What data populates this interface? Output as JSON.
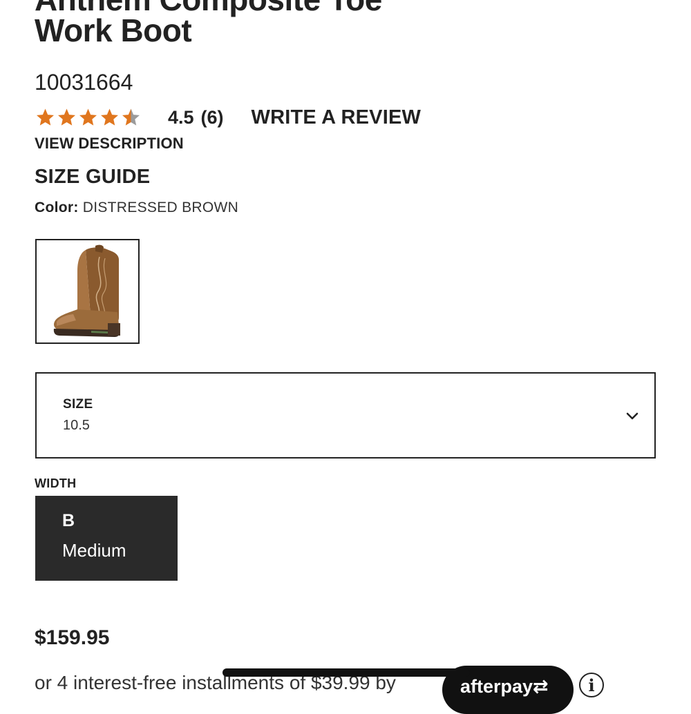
{
  "product": {
    "title_line1": "Anthem Composite Toe",
    "title_line2": "Work Boot",
    "sku": "10031664",
    "rating": {
      "stars_value": 4.5,
      "stars_max": 5,
      "value_text": "4.5",
      "count_text": "(6)",
      "star_color": "#e0761e",
      "star_empty_color": "#9b9b9b"
    },
    "write_review_label": "WRITE A REVIEW",
    "view_description_label": "VIEW DESCRIPTION",
    "size_guide_label": "SIZE GUIDE",
    "color": {
      "label": "Color:",
      "value": "DISTRESSED BROWN"
    },
    "size": {
      "label": "SIZE",
      "value": "10.5"
    },
    "width": {
      "label": "WIDTH",
      "option_code": "B",
      "option_name": "Medium"
    },
    "price": "$159.95",
    "installments_text": "or 4 interest-free installments of $39.99 by",
    "afterpay_label": "afterpay",
    "info_icon_glyph": "i"
  }
}
